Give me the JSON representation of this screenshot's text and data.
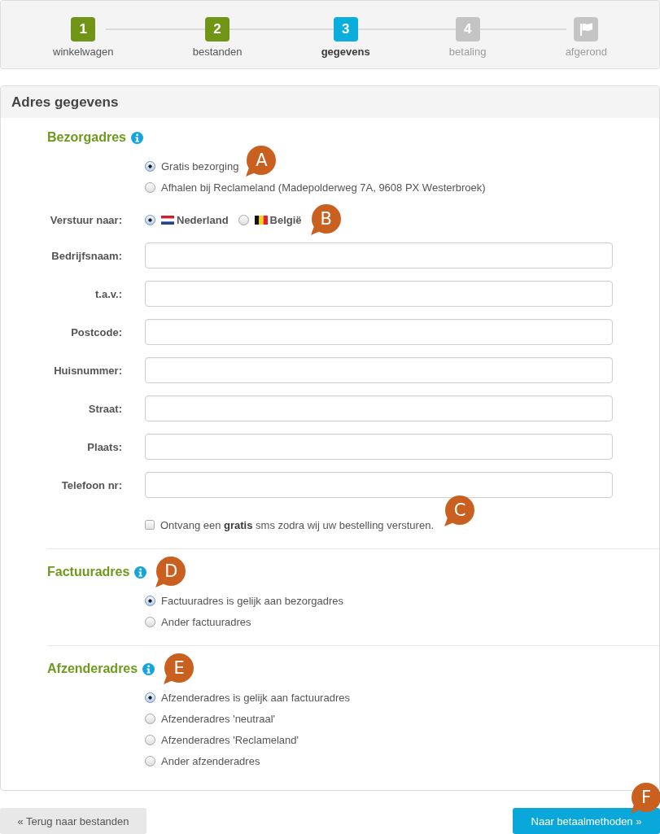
{
  "steps": [
    {
      "kind": "number",
      "number": "1",
      "label": "winkelwagen",
      "completed": true,
      "selected": false
    },
    {
      "kind": "number",
      "number": "2",
      "label": "bestanden",
      "completed": true,
      "selected": false
    },
    {
      "kind": "number",
      "number": "3",
      "label": "gegevens",
      "completed": false,
      "selected": true
    },
    {
      "kind": "number",
      "number": "4",
      "label": "betaling",
      "completed": false,
      "selected": false
    },
    {
      "kind": "flag",
      "label": "afgerond",
      "completed": false,
      "selected": false
    }
  ],
  "panel": {
    "title": "Adres gegevens",
    "delivery": {
      "heading": "Bezorgadres",
      "options": [
        {
          "label": "Gratis bezorging",
          "selected": true,
          "marker": "A"
        },
        {
          "label": "Afhalen bij Reclameland (Madepolderweg 7A, 9608 PX Westerbroek)",
          "selected": false
        }
      ],
      "ship_to": {
        "label": "Verstuur naar:",
        "countries": [
          {
            "kind": "dutch",
            "label": "Nederland",
            "selected": true
          },
          {
            "kind": "belgian",
            "label": "België",
            "selected": false,
            "marker": "B"
          }
        ]
      },
      "fields": [
        {
          "label": "Bedrijfsnaam:"
        },
        {
          "label": "t.a.v.:"
        },
        {
          "label": "Postcode:"
        },
        {
          "label": "Huisnummer:"
        },
        {
          "label": "Straat:"
        },
        {
          "label": "Plaats:"
        },
        {
          "label": "Telefoon nr:"
        }
      ],
      "sms": {
        "label": "Ontvang een **gratis** sms zodra wij uw bestelling versturen.",
        "checked": false,
        "marker": "C"
      }
    },
    "billing": {
      "heading": "Factuuradres",
      "marker": "D",
      "options": [
        {
          "label": "Factuuradres is gelijk aan bezorgadres",
          "selected": true
        },
        {
          "label": "Ander factuuradres",
          "selected": false
        }
      ]
    },
    "sender": {
      "heading": "Afzenderadres",
      "marker": "E",
      "options": [
        {
          "label": "Afzenderadres is gelijk aan factuuradres",
          "selected": true
        },
        {
          "label": "Afzenderadres 'neutraal'",
          "selected": false
        },
        {
          "label": "Afzenderadres 'Reclameland'",
          "selected": false
        },
        {
          "label": "Ander afzenderadres",
          "selected": false
        }
      ]
    }
  },
  "buttons": {
    "back": {
      "label": "« Terug naar bestanden"
    },
    "next": {
      "label": "Naar betaalmethoden »",
      "marker": "F"
    }
  }
}
